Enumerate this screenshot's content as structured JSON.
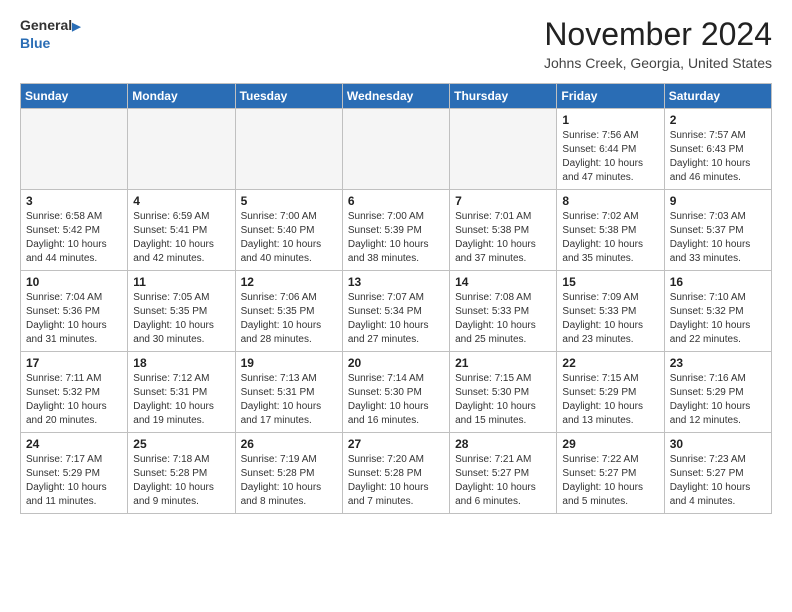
{
  "header": {
    "logo_line1": "General",
    "logo_line2": "Blue",
    "month": "November 2024",
    "location": "Johns Creek, Georgia, United States"
  },
  "weekdays": [
    "Sunday",
    "Monday",
    "Tuesday",
    "Wednesday",
    "Thursday",
    "Friday",
    "Saturday"
  ],
  "weeks": [
    [
      {
        "day": "",
        "info": ""
      },
      {
        "day": "",
        "info": ""
      },
      {
        "day": "",
        "info": ""
      },
      {
        "day": "",
        "info": ""
      },
      {
        "day": "",
        "info": ""
      },
      {
        "day": "1",
        "info": "Sunrise: 7:56 AM\nSunset: 6:44 PM\nDaylight: 10 hours\nand 47 minutes."
      },
      {
        "day": "2",
        "info": "Sunrise: 7:57 AM\nSunset: 6:43 PM\nDaylight: 10 hours\nand 46 minutes."
      }
    ],
    [
      {
        "day": "3",
        "info": "Sunrise: 6:58 AM\nSunset: 5:42 PM\nDaylight: 10 hours\nand 44 minutes."
      },
      {
        "day": "4",
        "info": "Sunrise: 6:59 AM\nSunset: 5:41 PM\nDaylight: 10 hours\nand 42 minutes."
      },
      {
        "day": "5",
        "info": "Sunrise: 7:00 AM\nSunset: 5:40 PM\nDaylight: 10 hours\nand 40 minutes."
      },
      {
        "day": "6",
        "info": "Sunrise: 7:00 AM\nSunset: 5:39 PM\nDaylight: 10 hours\nand 38 minutes."
      },
      {
        "day": "7",
        "info": "Sunrise: 7:01 AM\nSunset: 5:38 PM\nDaylight: 10 hours\nand 37 minutes."
      },
      {
        "day": "8",
        "info": "Sunrise: 7:02 AM\nSunset: 5:38 PM\nDaylight: 10 hours\nand 35 minutes."
      },
      {
        "day": "9",
        "info": "Sunrise: 7:03 AM\nSunset: 5:37 PM\nDaylight: 10 hours\nand 33 minutes."
      }
    ],
    [
      {
        "day": "10",
        "info": "Sunrise: 7:04 AM\nSunset: 5:36 PM\nDaylight: 10 hours\nand 31 minutes."
      },
      {
        "day": "11",
        "info": "Sunrise: 7:05 AM\nSunset: 5:35 PM\nDaylight: 10 hours\nand 30 minutes."
      },
      {
        "day": "12",
        "info": "Sunrise: 7:06 AM\nSunset: 5:35 PM\nDaylight: 10 hours\nand 28 minutes."
      },
      {
        "day": "13",
        "info": "Sunrise: 7:07 AM\nSunset: 5:34 PM\nDaylight: 10 hours\nand 27 minutes."
      },
      {
        "day": "14",
        "info": "Sunrise: 7:08 AM\nSunset: 5:33 PM\nDaylight: 10 hours\nand 25 minutes."
      },
      {
        "day": "15",
        "info": "Sunrise: 7:09 AM\nSunset: 5:33 PM\nDaylight: 10 hours\nand 23 minutes."
      },
      {
        "day": "16",
        "info": "Sunrise: 7:10 AM\nSunset: 5:32 PM\nDaylight: 10 hours\nand 22 minutes."
      }
    ],
    [
      {
        "day": "17",
        "info": "Sunrise: 7:11 AM\nSunset: 5:32 PM\nDaylight: 10 hours\nand 20 minutes."
      },
      {
        "day": "18",
        "info": "Sunrise: 7:12 AM\nSunset: 5:31 PM\nDaylight: 10 hours\nand 19 minutes."
      },
      {
        "day": "19",
        "info": "Sunrise: 7:13 AM\nSunset: 5:31 PM\nDaylight: 10 hours\nand 17 minutes."
      },
      {
        "day": "20",
        "info": "Sunrise: 7:14 AM\nSunset: 5:30 PM\nDaylight: 10 hours\nand 16 minutes."
      },
      {
        "day": "21",
        "info": "Sunrise: 7:15 AM\nSunset: 5:30 PM\nDaylight: 10 hours\nand 15 minutes."
      },
      {
        "day": "22",
        "info": "Sunrise: 7:15 AM\nSunset: 5:29 PM\nDaylight: 10 hours\nand 13 minutes."
      },
      {
        "day": "23",
        "info": "Sunrise: 7:16 AM\nSunset: 5:29 PM\nDaylight: 10 hours\nand 12 minutes."
      }
    ],
    [
      {
        "day": "24",
        "info": "Sunrise: 7:17 AM\nSunset: 5:29 PM\nDaylight: 10 hours\nand 11 minutes."
      },
      {
        "day": "25",
        "info": "Sunrise: 7:18 AM\nSunset: 5:28 PM\nDaylight: 10 hours\nand 9 minutes."
      },
      {
        "day": "26",
        "info": "Sunrise: 7:19 AM\nSunset: 5:28 PM\nDaylight: 10 hours\nand 8 minutes."
      },
      {
        "day": "27",
        "info": "Sunrise: 7:20 AM\nSunset: 5:28 PM\nDaylight: 10 hours\nand 7 minutes."
      },
      {
        "day": "28",
        "info": "Sunrise: 7:21 AM\nSunset: 5:27 PM\nDaylight: 10 hours\nand 6 minutes."
      },
      {
        "day": "29",
        "info": "Sunrise: 7:22 AM\nSunset: 5:27 PM\nDaylight: 10 hours\nand 5 minutes."
      },
      {
        "day": "30",
        "info": "Sunrise: 7:23 AM\nSunset: 5:27 PM\nDaylight: 10 hours\nand 4 minutes."
      }
    ]
  ]
}
